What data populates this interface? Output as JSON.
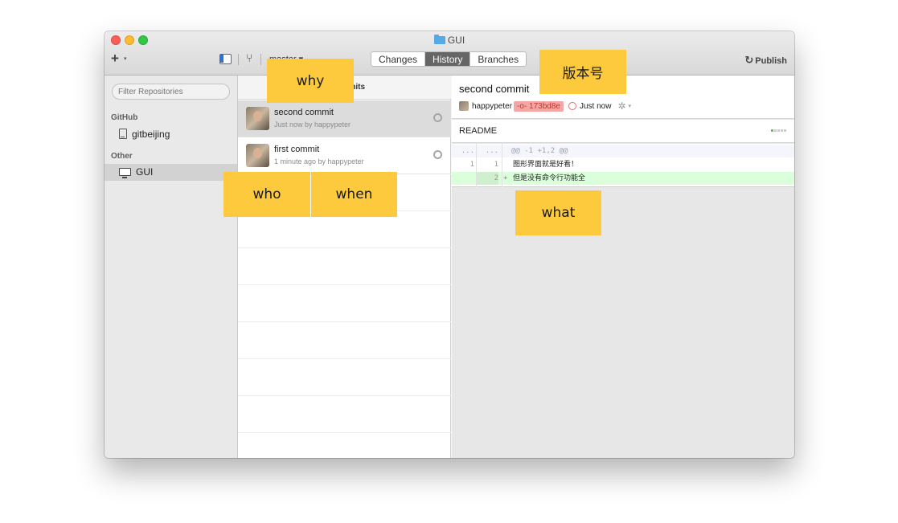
{
  "window": {
    "title": "GUI",
    "folder_icon": "folder-icon"
  },
  "toolbar": {
    "add_label": "+",
    "add_caret": "▾",
    "branch_label": "master ▾",
    "tabs": [
      {
        "label": "Changes",
        "active": false
      },
      {
        "label": "History",
        "active": true
      },
      {
        "label": "Branches",
        "active": false
      }
    ],
    "publish_icon": "↻",
    "publish_label": "Publish"
  },
  "sidebar": {
    "filter_placeholder": "Filter Repositories",
    "groups": [
      {
        "label": "GitHub",
        "items": [
          {
            "label": "gitbeijing",
            "icon": "repo-icon"
          }
        ]
      },
      {
        "label": "Other",
        "items": [
          {
            "label": "GUI",
            "icon": "monitor-icon",
            "selected": true
          }
        ]
      }
    ]
  },
  "commit_list": {
    "header": "2 Commits",
    "commits": [
      {
        "title": "second commit",
        "sub": "Just now by happypeter",
        "selected": true
      },
      {
        "title": "first commit",
        "sub": "1 minute ago by happypeter",
        "selected": false
      }
    ]
  },
  "detail": {
    "title": "second commit",
    "author": "happypeter",
    "sha": "-o- 173bd8e",
    "time": "Just now",
    "file": "README",
    "diff": {
      "hunk": "@@ -1 +1,2 @@",
      "hunk_ln": "...",
      "lines": [
        {
          "old": "1",
          "new": "1",
          "sign": "",
          "text": "图形界面就是好看！",
          "type": "context"
        },
        {
          "old": "",
          "new": "2",
          "sign": "+",
          "text": "但是没有命令行功能全",
          "type": "added"
        }
      ]
    }
  },
  "annotations": {
    "why": "why",
    "who": "who",
    "when": "when",
    "what": "what",
    "version": "版本号"
  },
  "colors": {
    "annotation": "#fdc93d",
    "sha_badge": "#f3a6a6",
    "added_line": "#dbffdb",
    "active_tab": "#666666"
  }
}
